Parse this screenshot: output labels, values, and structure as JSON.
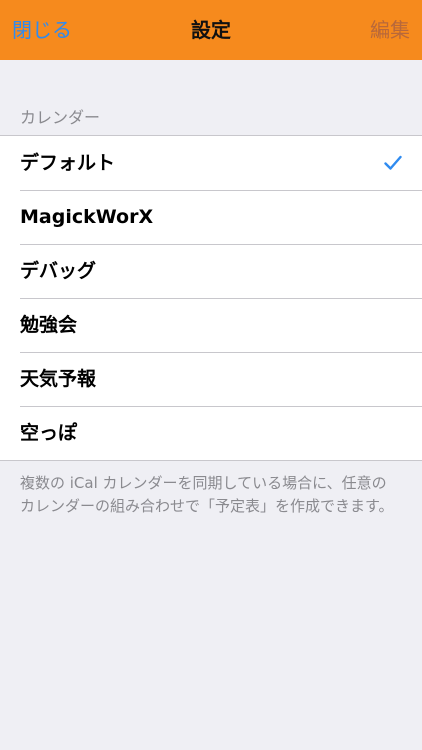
{
  "navbar": {
    "close_label": "閉じる",
    "title": "設定",
    "edit_label": "編集"
  },
  "section": {
    "header": "カレンダー",
    "items": [
      {
        "label": "デフォルト",
        "checked": true
      },
      {
        "label": "MagickWorX",
        "checked": false
      },
      {
        "label": "デバッグ",
        "checked": false
      },
      {
        "label": "勉強会",
        "checked": false
      },
      {
        "label": "天気予報",
        "checked": false
      },
      {
        "label": "空っぽ",
        "checked": false
      }
    ],
    "footer": "複数の iCal カレンダーを同期している場合に、任意のカレンダーの組み合わせで「予定表」を作成できます。"
  },
  "colors": {
    "navbar": "#f68a1d",
    "accent": "#2f8bf0",
    "edit": "#b8683a",
    "background": "#efeff4"
  },
  "icons": {
    "checkmark": "checkmark-icon"
  }
}
